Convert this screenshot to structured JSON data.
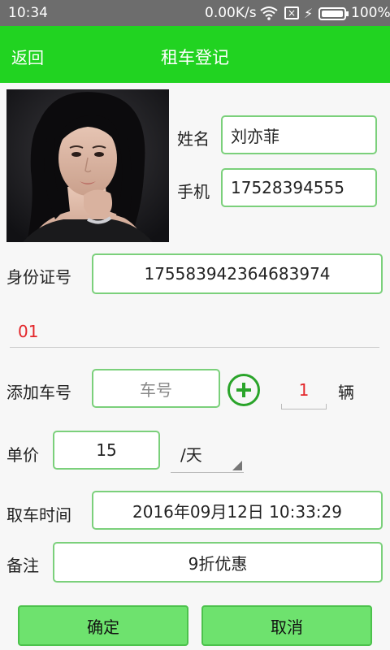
{
  "status_bar": {
    "time": "10:34",
    "net_speed": "0.00K/s",
    "battery_percent": "100%",
    "battery_level": 1.0
  },
  "header": {
    "back_label": "返回",
    "title": "租车登记"
  },
  "form": {
    "name_label": "姓名",
    "name_value": "刘亦菲",
    "phone_label": "手机",
    "phone_value": "17528394555",
    "id_label": "身份证号",
    "id_value": "17558394236468397",
    "id_value_tail": "4",
    "code_value": "01",
    "add_car_label": "添加车号",
    "car_no_placeholder": "车号",
    "car_count": "1",
    "car_unit": "辆",
    "price_label": "单价",
    "price_value": "15",
    "price_unit": "/天",
    "pickup_label": "取车时间",
    "pickup_value": "2016年09月12日 10:33:29",
    "remark_label": "备注",
    "remark_value": "9折优惠"
  },
  "actions": {
    "confirm_label": "确定",
    "cancel_label": "取消"
  },
  "colors": {
    "header_green": "#21d321",
    "field_border": "#7bd07b",
    "button_green": "#6ee26e",
    "accent_red": "#e3262a"
  }
}
